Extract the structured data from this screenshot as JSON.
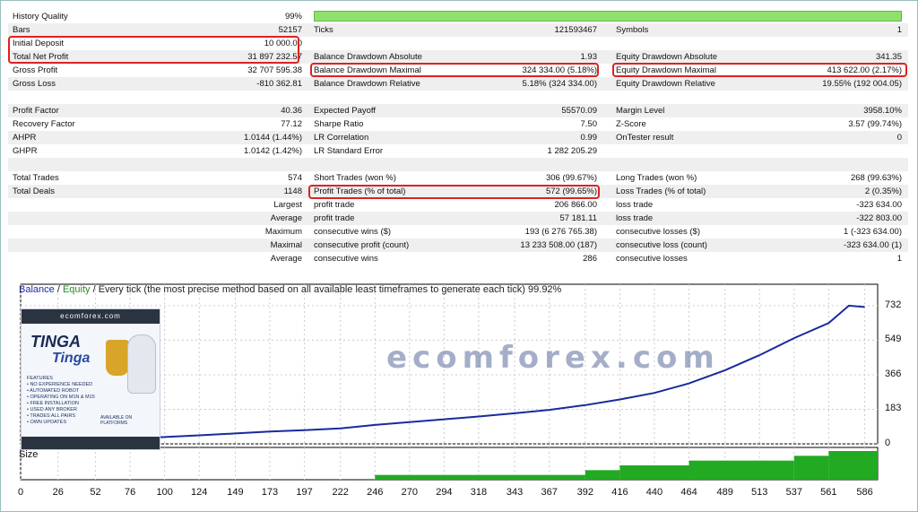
{
  "colors": {
    "quality_bar": "#8fe06c",
    "balance_line": "#1a2a9c",
    "volume_bars": "#22aa22",
    "highlight": "#dd2222"
  },
  "report": {
    "rows": [
      {
        "l1": "History Quality",
        "v1": "99%",
        "bar": true
      },
      {
        "l1": "Bars",
        "v1": "52157",
        "l2": "Ticks",
        "v2": "121593467",
        "l3": "Symbols",
        "v3": "1"
      },
      {
        "l1": "Initial Deposit",
        "v1": "10 000.00"
      },
      {
        "l1": "Total Net Profit",
        "v1": "31 897 232.57",
        "l2": "Balance Drawdown Absolute",
        "v2": "1.93",
        "l3": "Equity Drawdown Absolute",
        "v3": "341.35"
      },
      {
        "l1": "Gross Profit",
        "v1": "32 707 595.38",
        "l2": "Balance Drawdown Maximal",
        "v2": "324 334.00 (5.18%)",
        "l3": "Equity Drawdown Maximal",
        "v3": "413 622.00 (2.17%)"
      },
      {
        "l1": "Gross Loss",
        "v1": "-810 362.81",
        "l2": "Balance Drawdown Relative",
        "v2": "5.18% (324 334.00)",
        "l3": "Equity Drawdown Relative",
        "v3": "19.55% (192 004.05)"
      },
      {},
      {
        "l1": "Profit Factor",
        "v1": "40.36",
        "l2": "Expected Payoff",
        "v2": "55570.09",
        "l3": "Margin Level",
        "v3": "3958.10%"
      },
      {
        "l1": "Recovery Factor",
        "v1": "77.12",
        "l2": "Sharpe Ratio",
        "v2": "7.50",
        "l3": "Z-Score",
        "v3": "3.57 (99.74%)"
      },
      {
        "l1": "AHPR",
        "v1": "1.0144 (1.44%)",
        "l2": "LR Correlation",
        "v2": "0.99",
        "l3": "OnTester result",
        "v3": "0"
      },
      {
        "l1": "GHPR",
        "v1": "1.0142 (1.42%)",
        "l2": "LR Standard Error",
        "v2": "1 282 205.29"
      },
      {},
      {
        "l1": "Total Trades",
        "v1": "574",
        "l2": "Short Trades (won %)",
        "v2": "306 (99.67%)",
        "l3": "Long Trades (won %)",
        "v3": "268 (99.63%)"
      },
      {
        "l1": "Total Deals",
        "v1": "1148",
        "l2": "Profit Trades (% of total)",
        "v2": "572 (99.65%)",
        "l3": "Loss Trades (% of total)",
        "v3": "2 (0.35%)"
      },
      {
        "lr": "Largest",
        "l2": "profit trade",
        "v2": "206 866.00",
        "l3": "loss trade",
        "v3": "-323 634.00"
      },
      {
        "lr": "Average",
        "l2": "profit trade",
        "v2": "57 181.11",
        "l3": "loss trade",
        "v3": "-322 803.00"
      },
      {
        "lr": "Maximum",
        "l2": "consecutive wins ($)",
        "v2": "193 (6 276 765.38)",
        "l3": "consecutive losses ($)",
        "v3": "1 (-323 634.00)"
      },
      {
        "lr": "Maximal",
        "l2": "consecutive profit (count)",
        "v2": "13 233 508.00 (187)",
        "l3": "consecutive loss (count)",
        "v3": "-323 634.00 (1)"
      },
      {
        "lr": "Average",
        "l2": "consecutive wins",
        "v2": "286",
        "l3": "consecutive losses",
        "v3": "1"
      }
    ]
  },
  "chart": {
    "title_balance": "Balance",
    "sep1": " / ",
    "title_equity": "Equity",
    "sep2": " / ",
    "title_rest": "Every tick (the most precise method based on all available least timeframes to generate each tick) 99.92%",
    "size_label": "Size"
  },
  "chart_data": {
    "type": "line",
    "series": [
      {
        "name": "Balance",
        "x": [
          0,
          26,
          52,
          76,
          100,
          124,
          149,
          173,
          197,
          222,
          246,
          270,
          294,
          318,
          343,
          367,
          392,
          416,
          440,
          464,
          489,
          513,
          537,
          561,
          575,
          586
        ],
        "y": [
          0,
          8,
          20,
          28,
          36,
          45,
          55,
          65,
          72,
          82,
          100,
          115,
          130,
          145,
          162,
          180,
          205,
          235,
          270,
          320,
          390,
          470,
          560,
          640,
          732,
          725
        ]
      }
    ],
    "x_ticks": [
      "0",
      "26",
      "52",
      "76",
      "100",
      "124",
      "149",
      "173",
      "197",
      "222",
      "246",
      "270",
      "294",
      "318",
      "343",
      "367",
      "392",
      "416",
      "440",
      "464",
      "489",
      "513",
      "537",
      "561",
      "586"
    ],
    "y_ticks": [
      "0",
      "183",
      "366",
      "549",
      "732"
    ],
    "ylim": [
      0,
      760
    ],
    "xlim": [
      0,
      595
    ],
    "volume_steps": [
      {
        "from": 0,
        "to": 246,
        "v": 0
      },
      {
        "from": 246,
        "to": 392,
        "v": 1
      },
      {
        "from": 392,
        "to": 416,
        "v": 2
      },
      {
        "from": 416,
        "to": 464,
        "v": 3
      },
      {
        "from": 464,
        "to": 537,
        "v": 4
      },
      {
        "from": 537,
        "to": 561,
        "v": 5
      },
      {
        "from": 561,
        "to": 595,
        "v": 6
      }
    ]
  },
  "watermark": {
    "text": "ecomforex.com"
  },
  "promo": {
    "header": "ecomforex.com",
    "title1": "TINGA",
    "title2": "Tinga",
    "features": [
      "FEATURES",
      "NO EXPERIENCE NEEDED",
      "AUTOMATED ROBOT",
      "OPERATING ON M1N & M15",
      "FREE INSTALLATION",
      "USED ANY BROKER",
      "TRADES ALL PAIRS",
      "OWN UPDATES"
    ],
    "avail": "AVAILABLE ON PLATFORMS"
  }
}
